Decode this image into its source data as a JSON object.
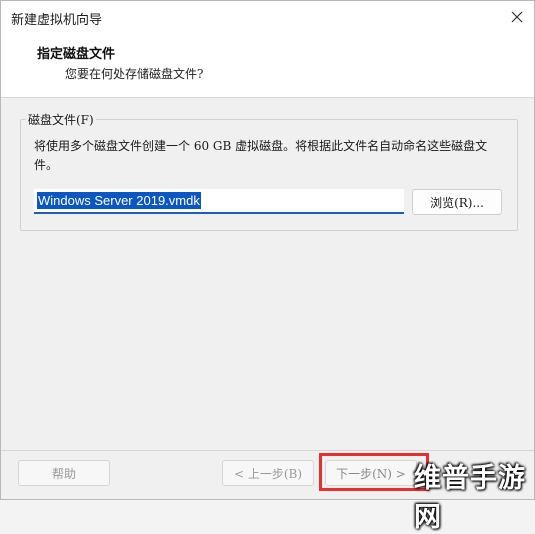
{
  "window": {
    "title": "新建虚拟机向导",
    "close_icon": "close-icon"
  },
  "header": {
    "title": "指定磁盘文件",
    "subtitle": "您要在何处存储磁盘文件?"
  },
  "disk_file_group": {
    "label": "磁盘文件(F)",
    "description": "将使用多个磁盘文件创建一个 60 GB 虚拟磁盘。将根据此文件名自动命名这些磁盘文件。",
    "file_name_value": "Windows Server 2019.vmdk",
    "browse_label": "浏览(R)..."
  },
  "footer": {
    "help_label": "帮助",
    "back_label": "< 上一步(B)",
    "next_label": "下一步(N) >"
  },
  "watermark": {
    "text": "维普手游网"
  },
  "colors": {
    "highlight_border": "#e53030",
    "selection": "#0a56c2",
    "input_underline": "#1c5fb8"
  }
}
